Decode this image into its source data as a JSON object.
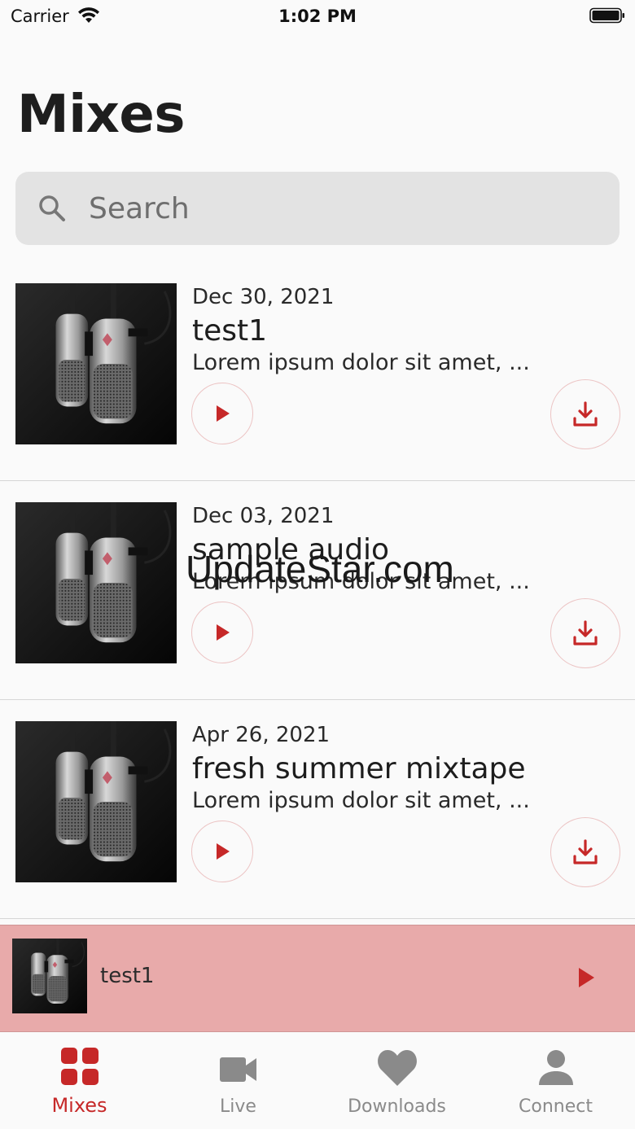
{
  "status_bar": {
    "carrier": "Carrier",
    "time": "1:02 PM"
  },
  "page": {
    "title": "Mixes"
  },
  "search": {
    "placeholder": "Search",
    "value": ""
  },
  "mixes": [
    {
      "date": "Dec 30, 2021",
      "title": "test1",
      "description": "Lorem ipsum dolor sit amet, ..."
    },
    {
      "date": "Dec 03, 2021",
      "title": "sample audio",
      "description": "Lorem ipsum dolor sit amet, ..."
    },
    {
      "date": "Apr 26, 2021",
      "title": "fresh summer mixtape",
      "description": "Lorem ipsum dolor sit amet, ..."
    }
  ],
  "watermark": "UpdateStar.com",
  "now_playing": {
    "title": "test1"
  },
  "tabs": [
    {
      "label": "Mixes",
      "icon": "grid-icon",
      "active": true
    },
    {
      "label": "Live",
      "icon": "video-camera-icon",
      "active": false
    },
    {
      "label": "Downloads",
      "icon": "heart-icon",
      "active": false
    },
    {
      "label": "Connect",
      "icon": "person-icon",
      "active": false
    }
  ],
  "colors": {
    "accent": "#c62828",
    "now_playing_bg": "#e8aaaa",
    "inactive_tab": "#8a8a8a"
  }
}
